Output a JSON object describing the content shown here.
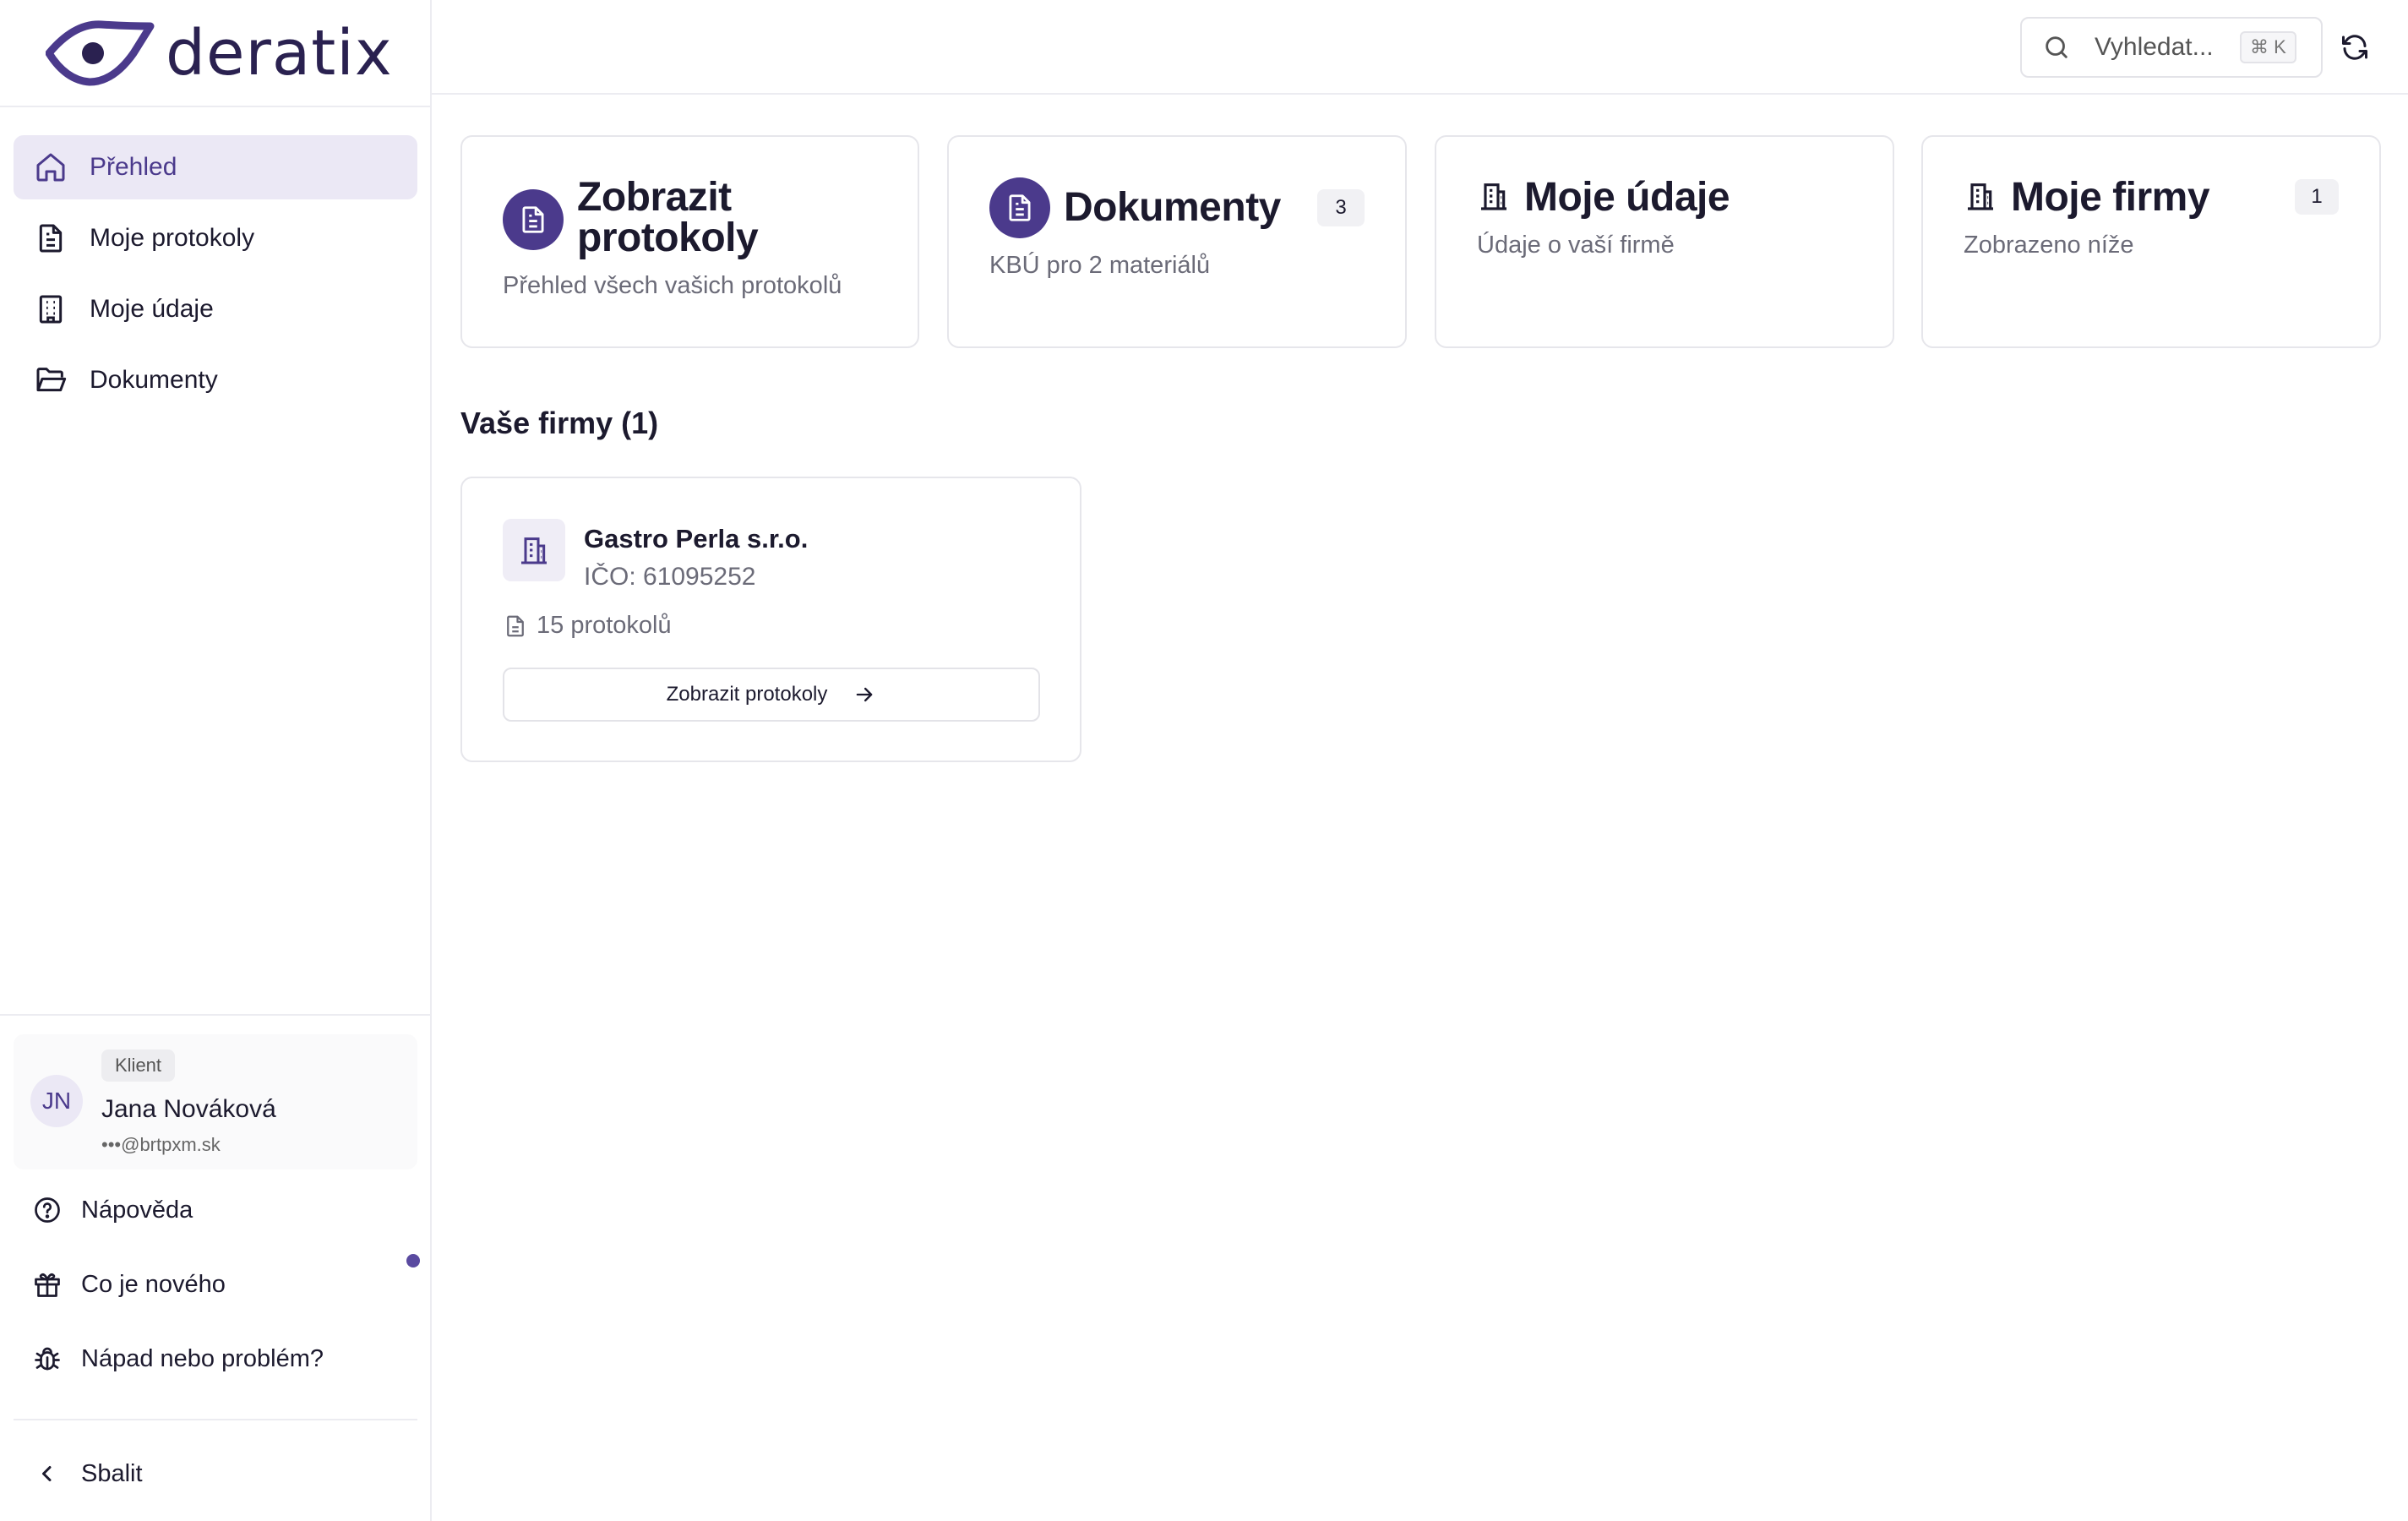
{
  "brand": {
    "name": "deratix",
    "color": "#4b3a8c"
  },
  "sidebar": {
    "items": [
      {
        "label": "Přehled",
        "icon": "home-icon",
        "active": true
      },
      {
        "label": "Moje protokoly",
        "icon": "file-text-icon",
        "active": false
      },
      {
        "label": "Moje údaje",
        "icon": "building-icon",
        "active": false
      },
      {
        "label": "Dokumenty",
        "icon": "folder-open-icon",
        "active": false
      }
    ],
    "user": {
      "initials": "JN",
      "role": "Klient",
      "name": "Jana Nováková",
      "email": "•••@brtpxm.sk"
    },
    "links": {
      "help": "Nápověda",
      "whats_new": "Co je nového",
      "feedback": "Nápad nebo problém?",
      "collapse": "Sbalit"
    }
  },
  "topbar": {
    "search_placeholder": "Vyhledat...",
    "shortcut": "⌘ K"
  },
  "cards": [
    {
      "title": "Zobrazit protokoly",
      "subtitle": "Přehled všech vašich protokolů",
      "icon": "file-text-icon"
    },
    {
      "title": "Dokumenty",
      "subtitle": "KBÚ pro 2 materiálů",
      "count": "3",
      "icon": "file-text-icon"
    },
    {
      "title": "Moje údaje",
      "subtitle": "Údaje o vaší firmě",
      "icon": "building-icon"
    },
    {
      "title": "Moje firmy",
      "subtitle": "Zobrazeno níže",
      "count": "1",
      "icon": "building-icon"
    }
  ],
  "firms": {
    "title": "Vaše firmy (1)",
    "items": [
      {
        "name": "Gastro Perla s.r.o.",
        "ico": "IČO: 61095252",
        "protocols": "15 protokolů",
        "button": "Zobrazit protokoly"
      }
    ]
  }
}
